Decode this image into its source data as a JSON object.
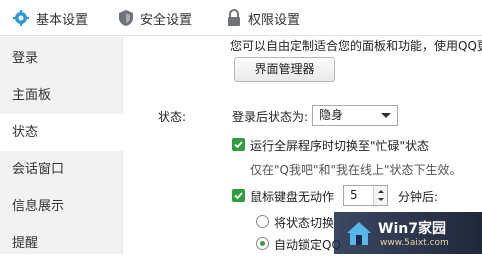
{
  "tabs": [
    {
      "label": "基本设置",
      "icon": "gear-icon"
    },
    {
      "label": "安全设置",
      "icon": "shield-icon"
    },
    {
      "label": "权限设置",
      "icon": "lock-icon"
    }
  ],
  "sidebar": {
    "items": [
      {
        "label": "登录"
      },
      {
        "label": "主面板"
      },
      {
        "label": "状态"
      },
      {
        "label": "会话窗口"
      },
      {
        "label": "信息展示"
      },
      {
        "label": "提醒"
      }
    ],
    "active_index": 2
  },
  "main": {
    "panel_desc": "您可以自由定制适合您的面板和功能，使用QQ更",
    "panel_manager_button": "界面管理器",
    "section_label": "状态:",
    "login_status_label": "登录后状态为:",
    "login_status_value": "隐身",
    "fullscreen_busy_label": "运行全屏程序时切换至\"忙碌\"状态",
    "fullscreen_note": "仅在\"Q我吧\"和\"我在线上\"状态下生效。",
    "idle_label": "鼠标键盘无动作",
    "idle_minutes": "5",
    "idle_suffix": "分钟后:",
    "radio_switch_label": "将状态切换",
    "radio_lock_label": "自动锁定QQ"
  },
  "watermark": {
    "title": "Win7家园",
    "url": "www.5aixt.com"
  },
  "colors": {
    "accent": "#2e9e3c",
    "sidebar_bg": "#f2f2f2",
    "brand_blue": "#2a9ad8"
  }
}
